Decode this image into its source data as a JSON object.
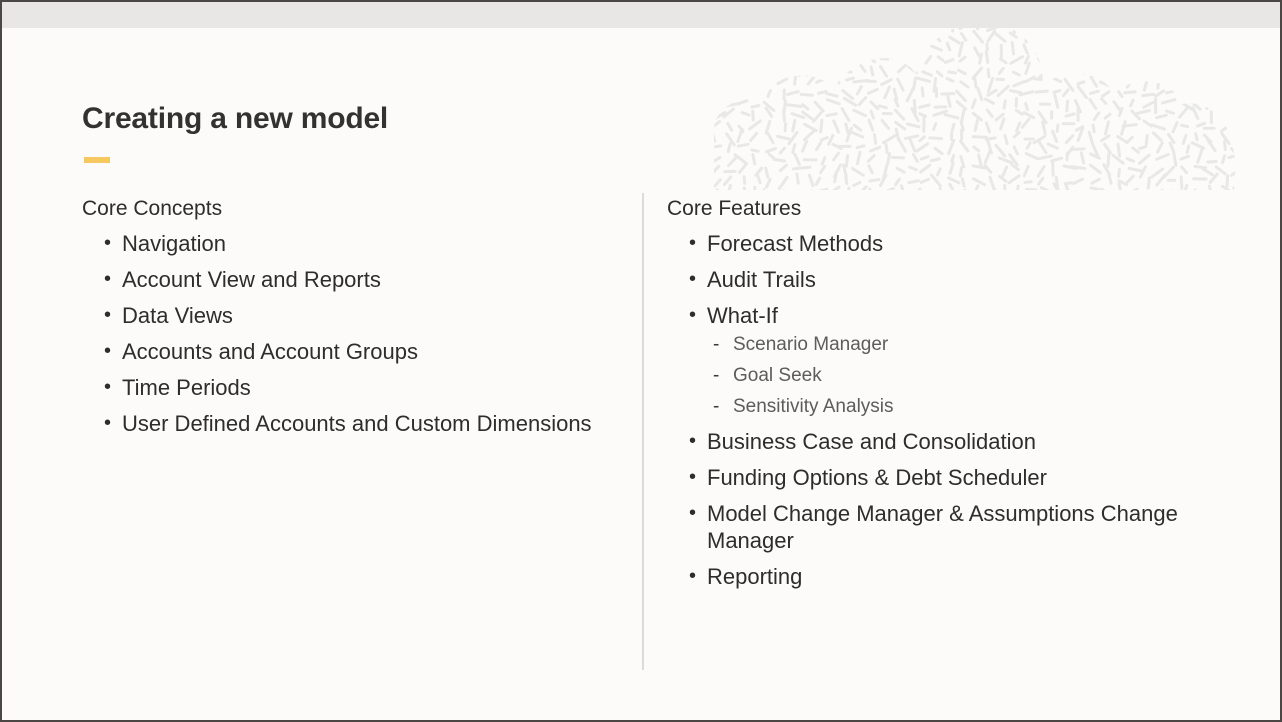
{
  "window": {
    "titlebar_label": "",
    "background_color": "#FCFBF9",
    "titlebar_color": "#E8E7E5",
    "border_color": "#4a4745"
  },
  "slide": {
    "title": "Creating a new model",
    "accent_color": "#F5C95F",
    "divider_color": "#DCDBD8",
    "decoration": {
      "name": "cloud-texture-graphic",
      "color": "#E8E8E6"
    },
    "columns": [
      {
        "heading": "Core Concepts",
        "items": [
          {
            "label": "Navigation"
          },
          {
            "label": "Account View and Reports"
          },
          {
            "label": "Data Views"
          },
          {
            "label": "Accounts and Account Groups"
          },
          {
            "label": "Time Periods"
          },
          {
            "label": "User Defined Accounts and Custom Dimensions"
          }
        ]
      },
      {
        "heading": "Core Features",
        "items": [
          {
            "label": "Forecast Methods"
          },
          {
            "label": "Audit Trails"
          },
          {
            "label": "What-If",
            "sub_items": [
              {
                "label": "Scenario Manager"
              },
              {
                "label": "Goal Seek"
              },
              {
                "label": "Sensitivity Analysis"
              }
            ]
          },
          {
            "label": "Business Case and Consolidation"
          },
          {
            "label": "Funding Options & Debt Scheduler"
          },
          {
            "label": "Model Change Manager & Assumptions Change Manager"
          },
          {
            "label": "Reporting"
          }
        ]
      }
    ]
  }
}
